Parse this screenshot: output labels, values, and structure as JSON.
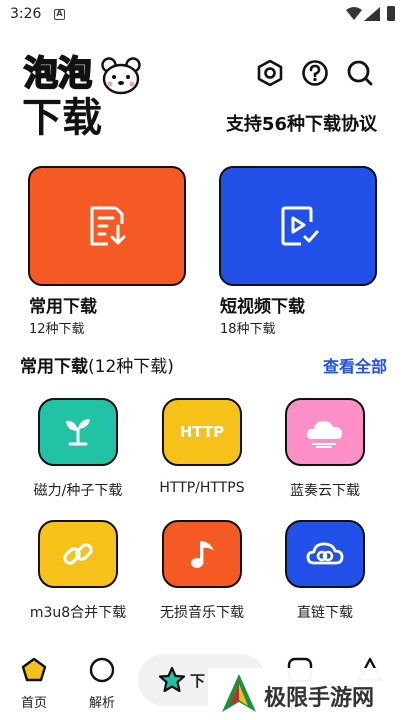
{
  "status_bar": {
    "time": "3:26",
    "notification_icon": "a-icon"
  },
  "header": {
    "logo_text": "泡泡",
    "logo_icon": "bear-icon",
    "title": "下载",
    "tagline": "支持56种下载协议",
    "icons": [
      "settings-hex-icon",
      "help-icon",
      "search-icon"
    ]
  },
  "cards": [
    {
      "title": "常用下载",
      "subtitle": "12种下载",
      "color": "#f55a24",
      "icon": "download-doc-icon"
    },
    {
      "title": "短视频下载",
      "subtitle": "18种下载",
      "color": "#2151e8",
      "icon": "video-check-icon"
    }
  ],
  "section": {
    "title": "常用下载",
    "count": "(12种下载)",
    "view_all": "查看全部"
  },
  "tiles": [
    {
      "label": "磁力/种子下载",
      "color": "#22c3a4",
      "icon": "sprout-icon"
    },
    {
      "label": "HTTP/HTTPS",
      "color": "#f6c21a",
      "icon_text": "HTTP"
    },
    {
      "label": "蓝奏云下载",
      "color": "#fb8fc6",
      "icon": "cloud-icon"
    },
    {
      "label": "m3u8合并下载",
      "color": "#f6c21a",
      "icon": "link-icon"
    },
    {
      "label": "无损音乐下载",
      "color": "#f55a24",
      "icon": "music-note-icon"
    },
    {
      "label": "直链下载",
      "color": "#2151e8",
      "icon": "cloud-link-icon"
    }
  ],
  "bottom_nav": [
    {
      "label": "首页",
      "icon": "home-pentagon-icon"
    },
    {
      "label": "解析",
      "icon": "circle-icon"
    },
    {
      "label": "下",
      "icon": "star-icon"
    },
    {
      "label": "",
      "icon": "square-icon"
    },
    {
      "label": "",
      "icon": "triangle-icon"
    }
  ],
  "watermark": {
    "text": "极限手游网",
    "icon": "watermark-logo-icon"
  },
  "colors": {
    "accent_blue": "#2151e8",
    "accent_orange": "#f55a24",
    "teal": "#22c3a4",
    "yellow": "#f6c21a",
    "pink": "#fb8fc6"
  }
}
